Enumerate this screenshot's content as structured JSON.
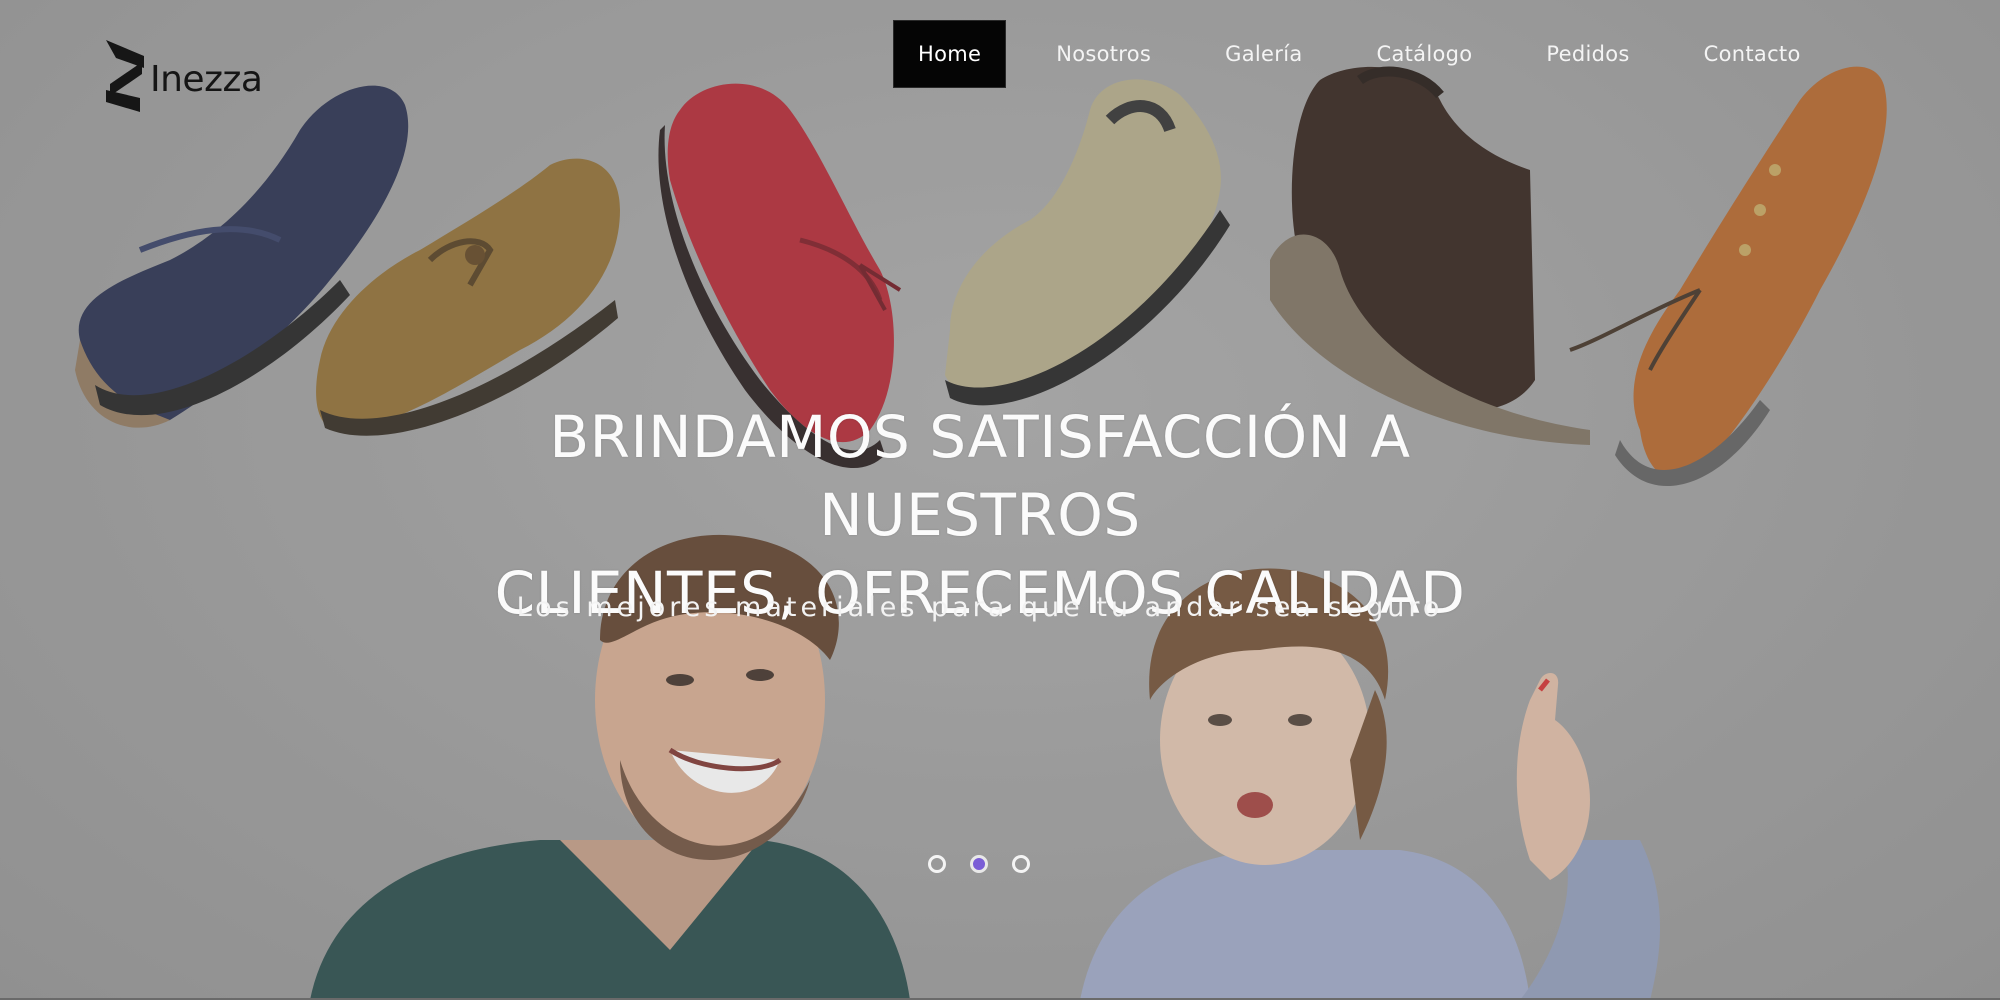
{
  "logo": {
    "text": "Inezza",
    "icon": "inezza-logo-mark"
  },
  "nav": {
    "items": [
      {
        "label": "Home",
        "active": true
      },
      {
        "label": "Nosotros",
        "active": false
      },
      {
        "label": "Galería",
        "active": false
      },
      {
        "label": "Catálogo",
        "active": false
      },
      {
        "label": "Pedidos",
        "active": false
      },
      {
        "label": "Contacto",
        "active": false
      }
    ]
  },
  "hero": {
    "headline_line1": "BRINDAMOS SATISFACCIÓN A NUESTROS",
    "headline_line2": "CLIENTES, OFRECEMOS CALIDAD",
    "subline": "Los mejores materiales para que tu andar sea seguro"
  },
  "carousel": {
    "slide_count": 3,
    "active_index": 1
  },
  "colors": {
    "background": "#9b9b9b",
    "nav_active_bg": "#050505",
    "text": "#f4f4f4",
    "dot_active": "#7a5dd6"
  }
}
